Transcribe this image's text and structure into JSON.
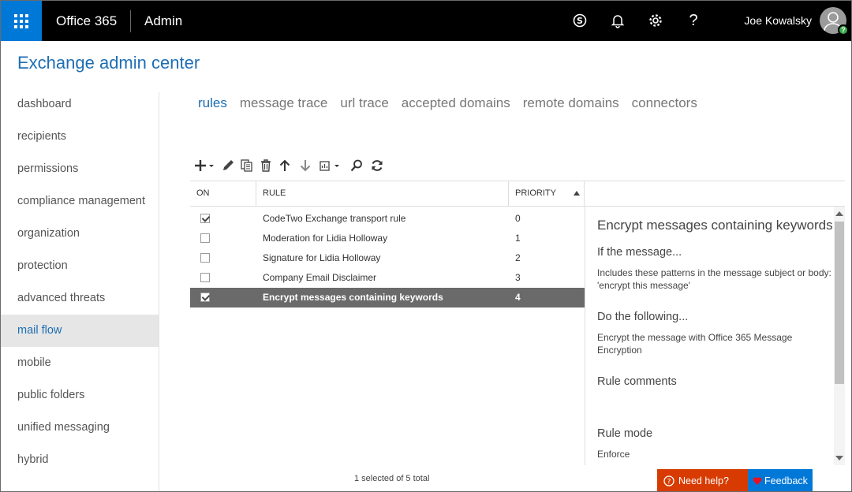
{
  "topbar": {
    "brand": "Office 365",
    "section": "Admin",
    "user_name": "Joe Kowalsky",
    "icons": [
      "skype-icon",
      "bell-icon",
      "gear-icon",
      "help-icon"
    ],
    "help_glyph": "?",
    "avatar_badge": "?",
    "waffle_color": "#0078d7"
  },
  "header": {
    "title": "Exchange admin center"
  },
  "nav": {
    "items": [
      {
        "label": "dashboard"
      },
      {
        "label": "recipients"
      },
      {
        "label": "permissions"
      },
      {
        "label": "compliance management"
      },
      {
        "label": "organization"
      },
      {
        "label": "protection"
      },
      {
        "label": "advanced threats"
      },
      {
        "label": "mail flow"
      },
      {
        "label": "mobile"
      },
      {
        "label": "public folders"
      },
      {
        "label": "unified messaging"
      },
      {
        "label": "hybrid"
      }
    ],
    "active": "mail flow"
  },
  "tabs": {
    "items": [
      "rules",
      "message trace",
      "url trace",
      "accepted domains",
      "remote domains",
      "connectors"
    ],
    "active": "rules"
  },
  "toolbar": {
    "icons": [
      "add-icon",
      "edit-icon",
      "copy-icon",
      "delete-icon",
      "move-up-icon",
      "move-down-icon",
      "more-icon",
      "search-icon",
      "refresh-icon"
    ]
  },
  "table": {
    "headers": {
      "on": "ON",
      "rule": "RULE",
      "priority": "PRIORITY"
    },
    "sort": "priority ascending",
    "rows": [
      {
        "on": true,
        "rule": "CodeTwo Exchange transport rule",
        "priority": "0"
      },
      {
        "on": false,
        "rule": "Moderation for Lidia Holloway",
        "priority": "1"
      },
      {
        "on": false,
        "rule": "Signature for Lidia Holloway",
        "priority": "2"
      },
      {
        "on": false,
        "rule": "Company Email Disclaimer",
        "priority": "3"
      },
      {
        "on": true,
        "rule": "Encrypt messages containing keywords",
        "priority": "4",
        "selected": true
      }
    ],
    "status": "1 selected of 5 total"
  },
  "detail": {
    "title": "Encrypt messages containing keywords",
    "if_heading": "If the message...",
    "if_text": "Includes these patterns in the message subject or body: 'encrypt this message'",
    "do_heading": "Do the following...",
    "do_text": "Encrypt the message with Office 365 Message Encryption",
    "comments_heading": "Rule comments",
    "mode_heading": "Rule mode",
    "mode_value": "Enforce"
  },
  "footer": {
    "need_help": "Need help?",
    "feedback": "Feedback",
    "need_help_color": "#d83b01",
    "feedback_color": "#0078d7"
  }
}
